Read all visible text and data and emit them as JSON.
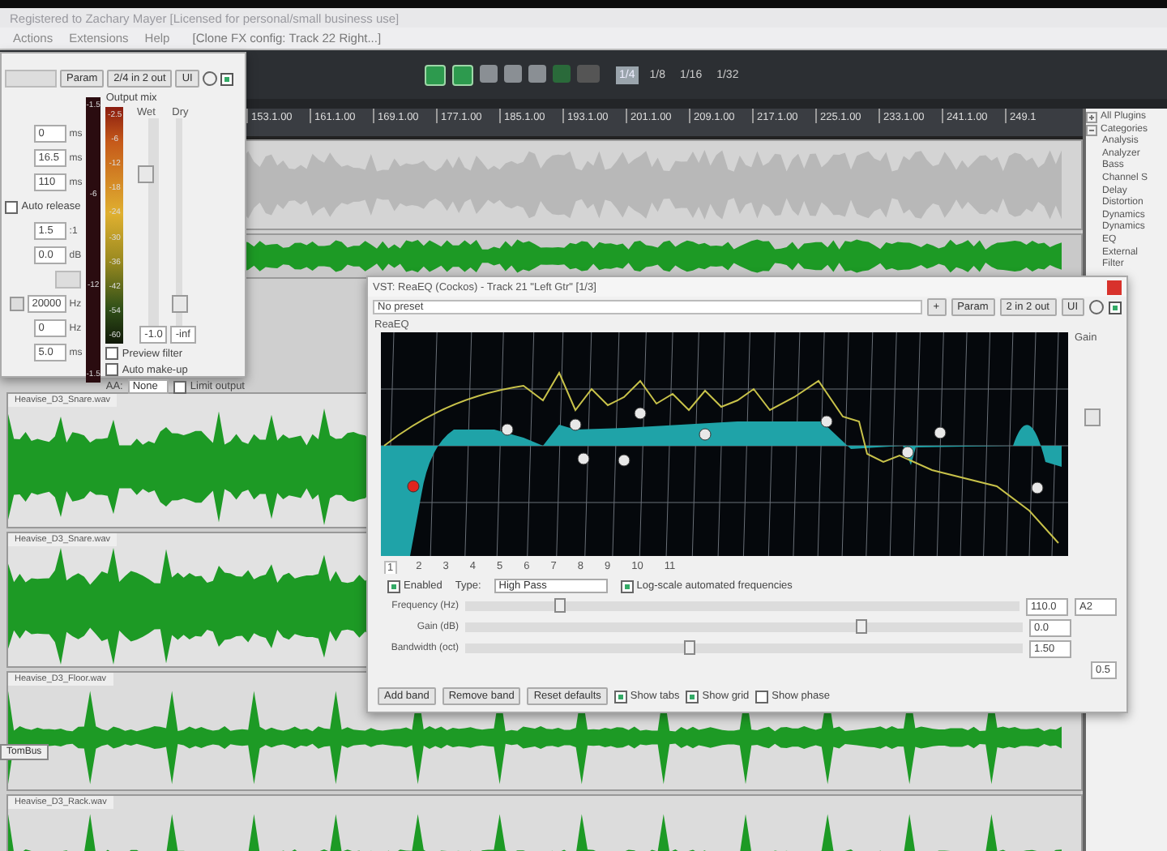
{
  "window": {
    "title": "Registered to Zachary Mayer [Licensed for personal/small business use]"
  },
  "menu": [
    {
      "label": "Actions"
    },
    {
      "label": "Extensions"
    },
    {
      "label": "Help"
    }
  ],
  "menu_note": "[Clone FX config: Track 22 Right...]",
  "grid_buttons": [
    {
      "label": "1/4",
      "selected": true
    },
    {
      "label": "1/8",
      "selected": false
    },
    {
      "label": "1/16",
      "selected": false
    },
    {
      "label": "1/32",
      "selected": false
    }
  ],
  "ruler": [
    "153.1.00",
    "161.1.00",
    "169.1.00",
    "177.1.00",
    "185.1.00",
    "193.1.00",
    "201.1.00",
    "209.1.00",
    "217.1.00",
    "225.1.00",
    "233.1.00",
    "241.1.00",
    "249.1"
  ],
  "tracks": [
    {
      "kind": "grey"
    },
    {
      "kind": "strip"
    },
    {
      "kind": "big",
      "name": "Heavise_D3_Snare.wav"
    },
    {
      "kind": "big",
      "name": "Heavise_D3_Snare.wav"
    },
    {
      "kind": "mid",
      "name": "Heavise_D3_Floor.wav"
    },
    {
      "kind": "mid",
      "name": "Heavise_D3_Rack.wav"
    }
  ],
  "track_label": "TomBus",
  "plugins": {
    "items": [
      {
        "label": "All Plugins",
        "expanded": false
      },
      {
        "label": "Categories",
        "expanded": true,
        "children": [
          {
            "label": "Analysis"
          },
          {
            "label": "Analyzer"
          },
          {
            "label": "Bass"
          },
          {
            "label": "Channel S"
          },
          {
            "label": "Delay"
          },
          {
            "label": "Distortion"
          },
          {
            "label": "Dynamics"
          },
          {
            "label": "Dynamics"
          },
          {
            "label": "EQ"
          },
          {
            "label": "External"
          },
          {
            "label": "Filter"
          }
        ]
      }
    ]
  },
  "compressor": {
    "buttons": [
      "Param",
      "2/4 in 2 out",
      "UI"
    ],
    "bypass": {
      "checked": true
    },
    "fields": [
      {
        "value": "0",
        "unit": "ms"
      },
      {
        "value": "16.5",
        "unit": "ms"
      },
      {
        "value": "110",
        "unit": "ms"
      },
      {
        "kind": "check",
        "label": "Auto release",
        "checked": false
      },
      {
        "value": "1.5",
        "unit": ":1"
      },
      {
        "value": "0.0",
        "unit": "dB"
      },
      {
        "kind": "gap"
      },
      {
        "value": "20000",
        "unit": "Hz"
      },
      {
        "value": "0",
        "unit": "Hz"
      },
      {
        "value": "5.0",
        "unit": "ms"
      }
    ],
    "meter_marks": [
      "-1.5",
      "-6",
      "-12",
      "-1.5"
    ],
    "output_mix": "Output mix",
    "wet": "Wet",
    "dry": "Dry",
    "output_marks": [
      "-2.5",
      "-6",
      "-12",
      "-18",
      "-24",
      "-30",
      "-36",
      "-42",
      "-54",
      "-60"
    ],
    "wet_value": "-1.0",
    "dry_value": "-inf",
    "checks": [
      {
        "label": "Preview filter",
        "checked": false
      },
      {
        "label": "Auto make-up",
        "checked": false
      }
    ],
    "aa_label": "AA:",
    "aa_value": "None",
    "limit": {
      "label": "Limit output",
      "checked": false
    }
  },
  "eq": {
    "title": "VST: ReaEQ (Cockos) - Track 21 \"Left Gtr\" [1/3]",
    "preset": "No preset",
    "buttons": [
      "+",
      "Param",
      "2 in 2 out",
      "UI"
    ],
    "bypass": {
      "checked": true
    },
    "plugin_name": "ReaEQ",
    "gain_label": "Gain",
    "bands": [
      {
        "label": "1",
        "selected": true
      },
      {
        "label": "2",
        "selected": false
      },
      {
        "label": "3",
        "selected": false
      },
      {
        "label": "4",
        "selected": false
      },
      {
        "label": "5",
        "selected": false
      },
      {
        "label": "6",
        "selected": false
      },
      {
        "label": "7",
        "selected": false
      },
      {
        "label": "8",
        "selected": false
      },
      {
        "label": "9",
        "selected": false
      },
      {
        "label": "10",
        "selected": false
      },
      {
        "label": "11",
        "selected": false
      }
    ],
    "enabled": {
      "label": "Enabled",
      "checked": true
    },
    "type_label": "Type:",
    "type_value": "High Pass",
    "log_scale": {
      "label": "Log-scale automated frequencies",
      "checked": true
    },
    "sliders": [
      {
        "label": "Frequency (Hz)",
        "level": 0.17,
        "value": "110.0",
        "note": "A2"
      },
      {
        "label": "Gain (dB)",
        "level": 0.71,
        "value": "0.0"
      },
      {
        "label": "Bandwidth (oct)",
        "level": 0.4,
        "value": "1.50"
      }
    ],
    "side_value": "0.5",
    "actions": [
      "Add band",
      "Remove band",
      "Reset defaults"
    ],
    "options": [
      {
        "label": "Show tabs",
        "checked": true
      },
      {
        "label": "Show grid",
        "checked": true
      },
      {
        "label": "Show phase",
        "checked": false
      }
    ]
  }
}
